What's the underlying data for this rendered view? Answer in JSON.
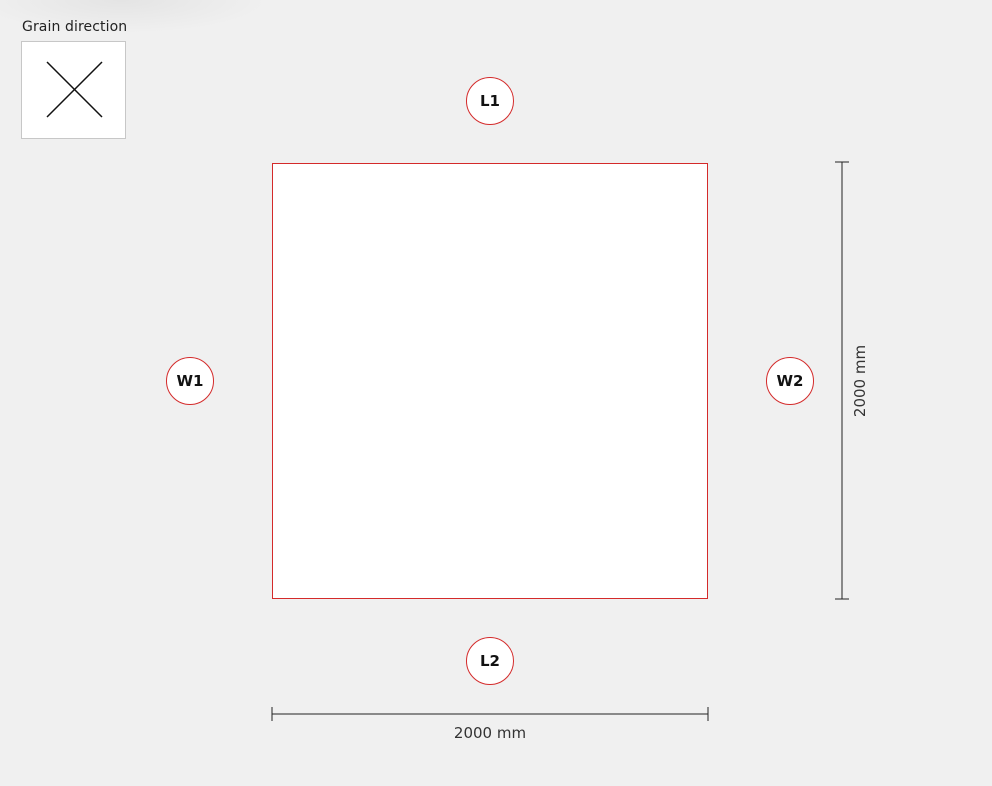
{
  "grain": {
    "label": "Grain direction",
    "icon": "cross-icon"
  },
  "panel": {
    "edges": {
      "top": "L1",
      "bottom": "L2",
      "left": "W1",
      "right": "W2"
    },
    "accent_color": "#d42a2a"
  },
  "dimensions": {
    "width_label": "2000 mm",
    "height_label": "2000 mm"
  }
}
